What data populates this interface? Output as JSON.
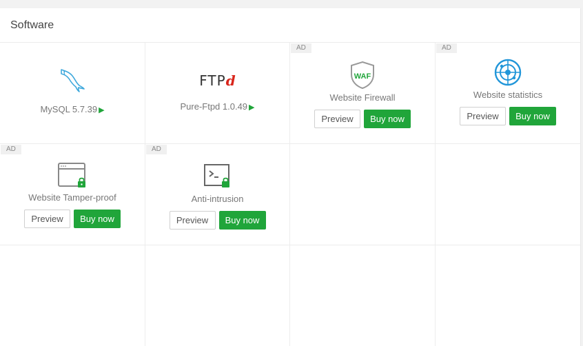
{
  "header": {
    "title": "Software"
  },
  "colors": {
    "accent": "#20a53a",
    "icon_blue": "#2196d9",
    "ftp_red": "#d9261c"
  },
  "items": [
    {
      "name": "MySQL 5.7.39",
      "icon": "mysql-dolphin-icon",
      "play": "▶"
    },
    {
      "name": "Pure-Ftpd 1.0.49",
      "icon": "ftpd-logo-icon",
      "logo_text": "FTP",
      "logo_accent": "d",
      "play": "▶"
    },
    {
      "ad": "AD",
      "name": "Website Firewall",
      "icon": "waf-shield-icon",
      "icon_text": "WAF",
      "preview": "Preview",
      "buy": "Buy now"
    },
    {
      "ad": "AD",
      "name": "Website statistics",
      "icon": "radar-target-icon",
      "preview": "Preview",
      "buy": "Buy now"
    },
    {
      "ad": "AD",
      "name": "Website Tamper-proof",
      "icon": "browser-lock-icon",
      "preview": "Preview",
      "buy": "Buy now"
    },
    {
      "ad": "AD",
      "name": "Anti-intrusion",
      "icon": "terminal-lock-icon",
      "preview": "Preview",
      "buy": "Buy now"
    }
  ]
}
